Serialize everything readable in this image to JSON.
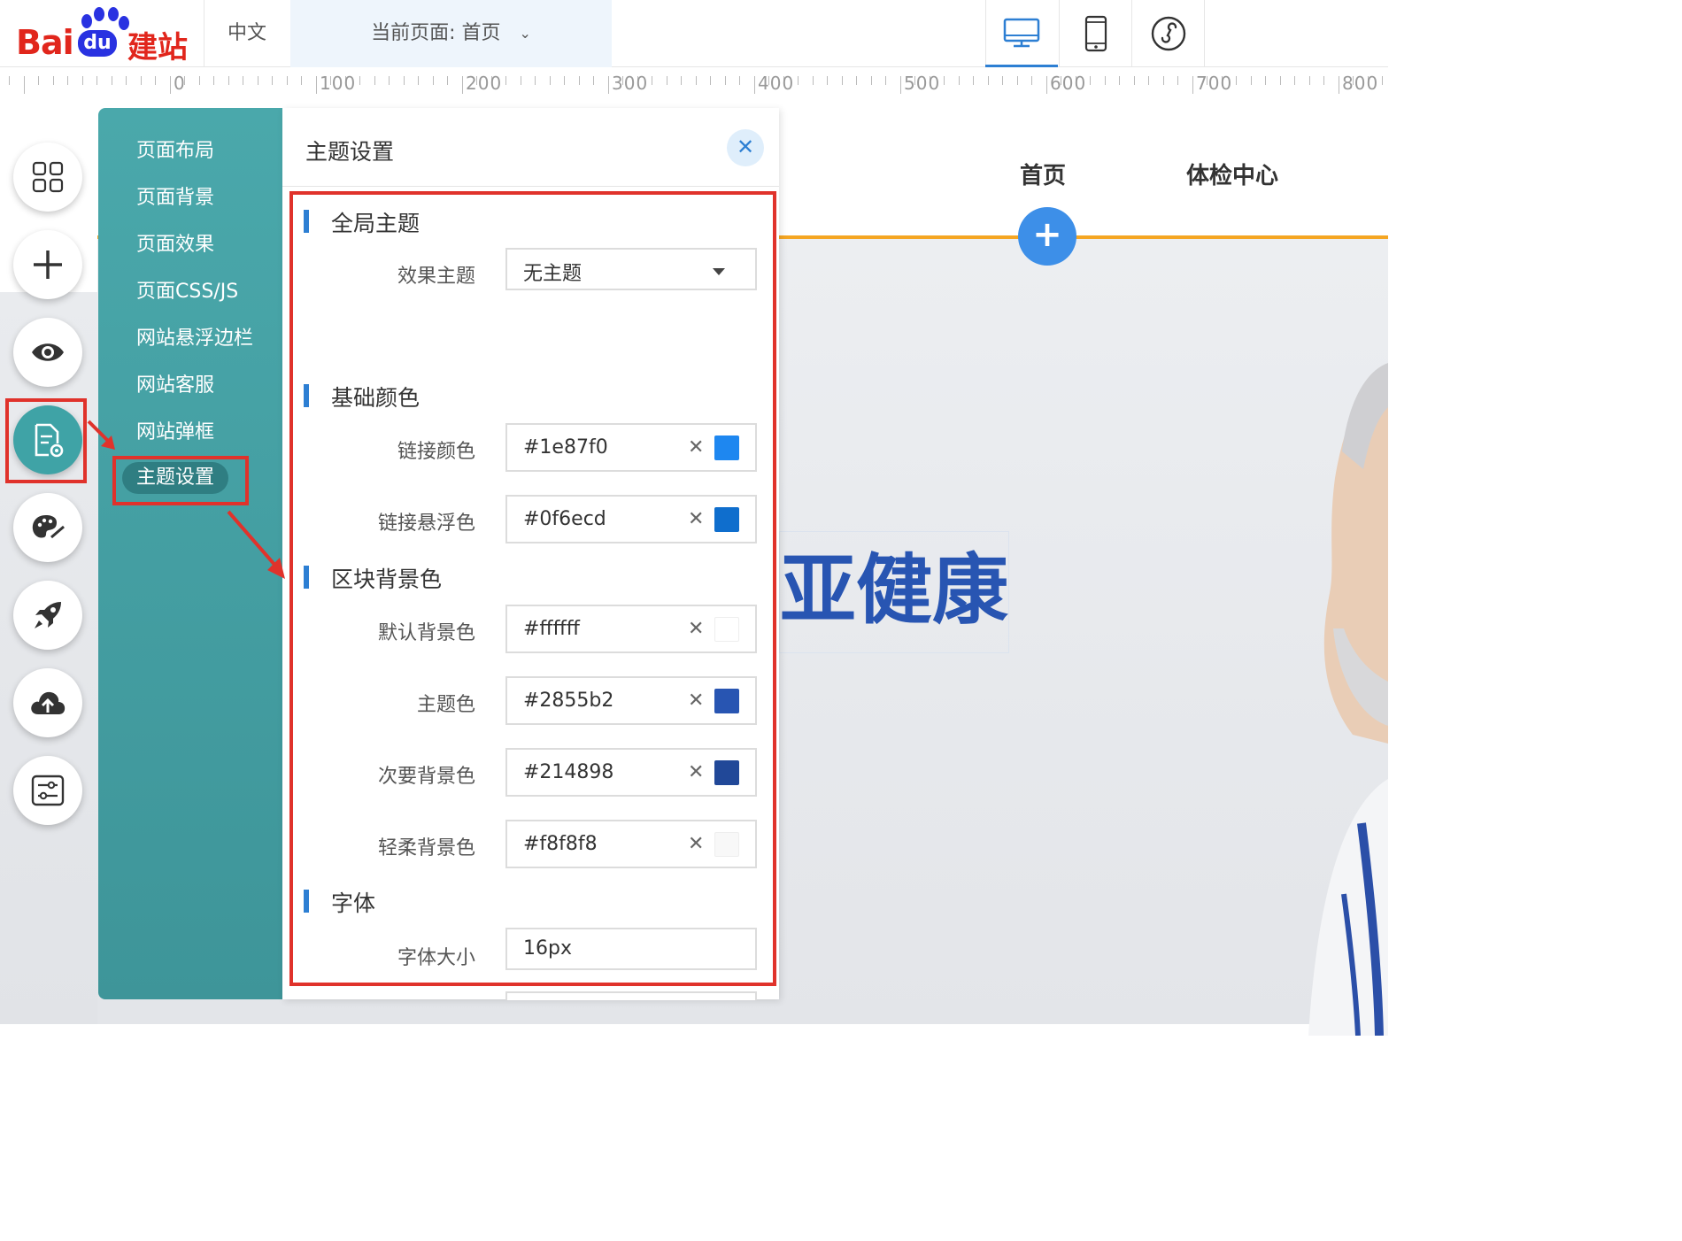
{
  "topbar": {
    "logo_bai": "Bai",
    "logo_du": "du",
    "logo_jz": "建站",
    "lang": "中文",
    "current_page": "当前页面: 首页"
  },
  "ruler": {
    "labels": [
      "0",
      "100",
      "200",
      "300",
      "400",
      "500",
      "600",
      "700",
      "800"
    ]
  },
  "site": {
    "nav": [
      "首页",
      "体检中心"
    ],
    "hero_text": "亚健康"
  },
  "side_menu": {
    "items": [
      "页面布局",
      "页面背景",
      "页面效果",
      "页面CSS/JS",
      "网站悬浮边栏",
      "网站客服",
      "网站弹框",
      "主题设置"
    ],
    "active_index": 7
  },
  "panel": {
    "title": "主题设置",
    "sections": {
      "global": {
        "title": "全局主题"
      },
      "basic_colors": {
        "title": "基础颜色"
      },
      "block_bg": {
        "title": "区块背景色"
      },
      "font": {
        "title": "字体"
      }
    },
    "fields": {
      "effect_theme": {
        "label": "效果主题",
        "value": "无主题"
      },
      "link_color": {
        "label": "链接颜色",
        "value": "#1e87f0"
      },
      "link_hover_color": {
        "label": "链接悬浮色",
        "value": "#0f6ecd"
      },
      "default_bg": {
        "label": "默认背景色",
        "value": "#ffffff"
      },
      "theme_color": {
        "label": "主题色",
        "value": "#2855b2"
      },
      "secondary_bg": {
        "label": "次要背景色",
        "value": "#214898"
      },
      "soft_bg": {
        "label": "轻柔背景色",
        "value": "#f8f8f8"
      },
      "font_size": {
        "label": "字体大小",
        "value": "16px"
      }
    }
  },
  "colors": {
    "accent": "#2d7fd3",
    "side_panel": "#45a0a3",
    "highlight_red": "#e0322b",
    "nav_line": "#f5a623"
  }
}
